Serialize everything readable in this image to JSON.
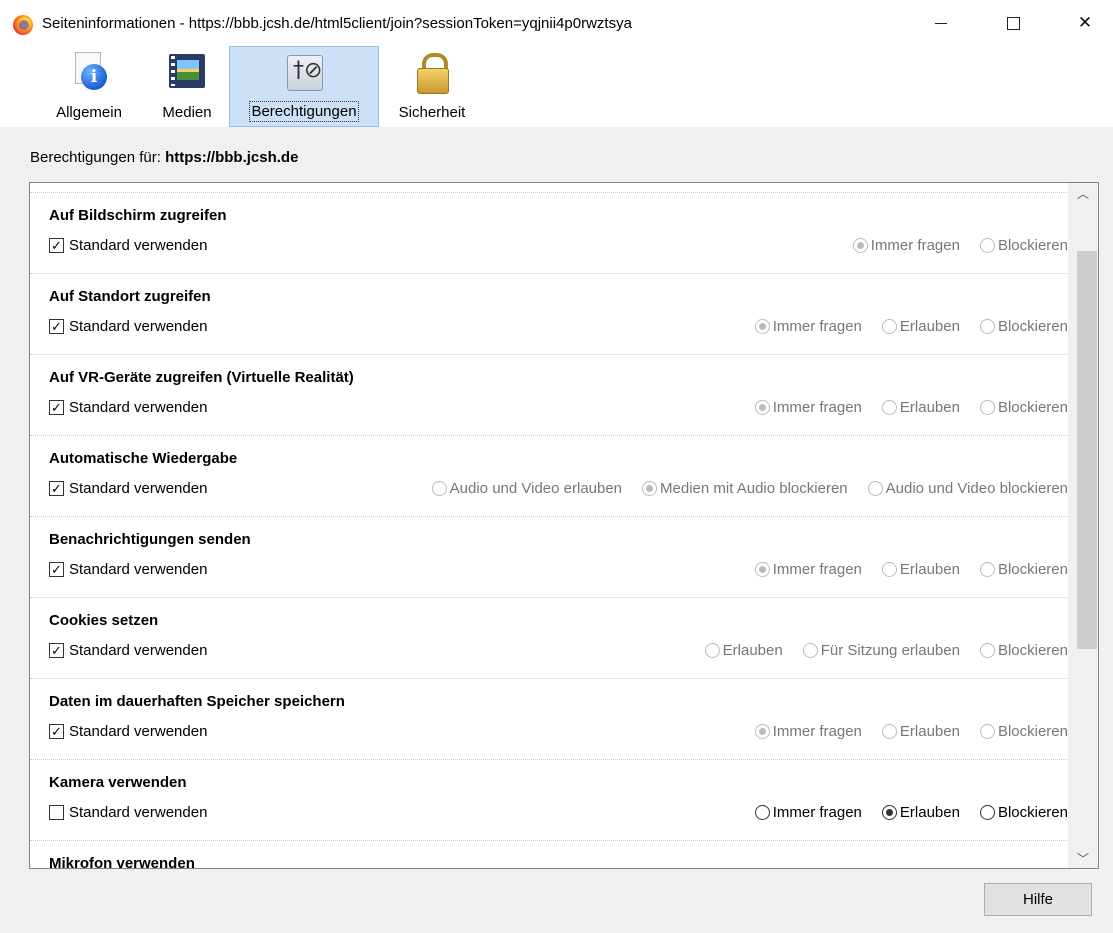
{
  "window": {
    "title": "Seiteninformationen - https://bbb.jcsh.de/html5client/join?sessionToken=yqjnii4p0rwztsya",
    "minimize": "—",
    "maximize": "☐",
    "close": "✕"
  },
  "tabs": [
    {
      "label": "Allgemein",
      "icon": "info-icon"
    },
    {
      "label": "Medien",
      "icon": "media-icon"
    },
    {
      "label": "Berechtigungen",
      "icon": "permissions-icon",
      "active": true
    },
    {
      "label": "Sicherheit",
      "icon": "lock-icon"
    }
  ],
  "permissions_for": {
    "label": "Berechtigungen für:",
    "host": "https://bbb.jcsh.de"
  },
  "rows": [
    {
      "title": "Auf Bildschirm zugreifen",
      "use_default": "Standard verwenden",
      "checked": true,
      "options": [
        {
          "label": "Immer fragen",
          "selected": true
        },
        {
          "label": "Blockieren",
          "selected": false
        }
      ]
    },
    {
      "title": "Auf Standort zugreifen",
      "use_default": "Standard verwenden",
      "checked": true,
      "options": [
        {
          "label": "Immer fragen",
          "selected": true
        },
        {
          "label": "Erlauben",
          "selected": false
        },
        {
          "label": "Blockieren",
          "selected": false
        }
      ]
    },
    {
      "title": "Auf VR-Geräte zugreifen (Virtuelle Realität)",
      "use_default": "Standard verwenden",
      "checked": true,
      "options": [
        {
          "label": "Immer fragen",
          "selected": true
        },
        {
          "label": "Erlauben",
          "selected": false
        },
        {
          "label": "Blockieren",
          "selected": false
        }
      ]
    },
    {
      "title": "Automatische Wiedergabe",
      "use_default": "Standard verwenden",
      "checked": true,
      "options": [
        {
          "label": "Audio und Video erlauben",
          "selected": false
        },
        {
          "label": "Medien mit Audio blockieren",
          "selected": true
        },
        {
          "label": "Audio und Video blockieren",
          "selected": false
        }
      ]
    },
    {
      "title": "Benachrichtigungen senden",
      "use_default": "Standard verwenden",
      "checked": true,
      "options": [
        {
          "label": "Immer fragen",
          "selected": true
        },
        {
          "label": "Erlauben",
          "selected": false
        },
        {
          "label": "Blockieren",
          "selected": false
        }
      ]
    },
    {
      "title": "Cookies setzen",
      "use_default": "Standard verwenden",
      "checked": true,
      "options": [
        {
          "label": "Erlauben",
          "selected": false
        },
        {
          "label": "Für Sitzung erlauben",
          "selected": false
        },
        {
          "label": "Blockieren",
          "selected": false
        }
      ]
    },
    {
      "title": "Daten im dauerhaften Speicher speichern",
      "use_default": "Standard verwenden",
      "checked": true,
      "options": [
        {
          "label": "Immer fragen",
          "selected": true
        },
        {
          "label": "Erlauben",
          "selected": false
        },
        {
          "label": "Blockieren",
          "selected": false
        }
      ]
    },
    {
      "title": "Kamera verwenden",
      "use_default": "Standard verwenden",
      "checked": false,
      "options": [
        {
          "label": "Immer fragen",
          "selected": false
        },
        {
          "label": "Erlauben",
          "selected": true
        },
        {
          "label": "Blockieren",
          "selected": false
        }
      ]
    },
    {
      "title": "Mikrofon verwenden",
      "use_default": "",
      "checked": false,
      "options": []
    }
  ],
  "scrollbar": {
    "up": "︿",
    "down": "﹀"
  },
  "help_button": "Hilfe"
}
